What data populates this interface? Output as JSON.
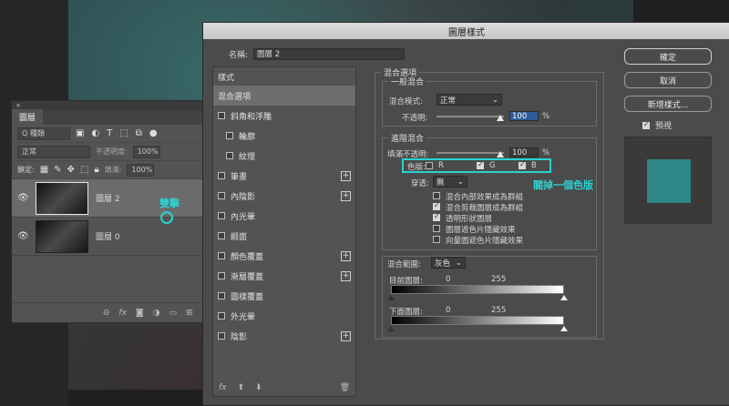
{
  "layers_panel": {
    "tab": "圖層",
    "filter": "Q 種類",
    "blend_mode": "正常",
    "opacity_label": "不透明度:",
    "opacity_value": "100%",
    "lock_label": "鎖定:",
    "fill_label": "填滿:",
    "fill_value": "100%",
    "layers": [
      {
        "name": "圖層 2",
        "selected": true
      },
      {
        "name": "圖層 0",
        "selected": false
      }
    ],
    "annotation": "雙擊"
  },
  "dialog": {
    "title": "圖層樣式",
    "name_label": "名稱:",
    "name_value": "圖層 2",
    "style_list": {
      "header": "樣式",
      "items": [
        {
          "label": "混合選項",
          "checkbox": false,
          "selected": true,
          "plus": false,
          "indent": false
        },
        {
          "label": "斜角和浮雕",
          "checkbox": true,
          "selected": false,
          "plus": false,
          "indent": false
        },
        {
          "label": "輪廓",
          "checkbox": true,
          "selected": false,
          "plus": false,
          "indent": true
        },
        {
          "label": "紋理",
          "checkbox": true,
          "selected": false,
          "plus": false,
          "indent": true
        },
        {
          "label": "筆畫",
          "checkbox": true,
          "selected": false,
          "plus": true,
          "indent": false
        },
        {
          "label": "內陰影",
          "checkbox": true,
          "selected": false,
          "plus": true,
          "indent": false
        },
        {
          "label": "內光暈",
          "checkbox": true,
          "selected": false,
          "plus": false,
          "indent": false
        },
        {
          "label": "緞面",
          "checkbox": true,
          "selected": false,
          "plus": false,
          "indent": false
        },
        {
          "label": "顏色覆蓋",
          "checkbox": true,
          "selected": false,
          "plus": true,
          "indent": false
        },
        {
          "label": "漸層覆蓋",
          "checkbox": true,
          "selected": false,
          "plus": true,
          "indent": false
        },
        {
          "label": "圖樣覆蓋",
          "checkbox": true,
          "selected": false,
          "plus": false,
          "indent": false
        },
        {
          "label": "外光暈",
          "checkbox": true,
          "selected": false,
          "plus": false,
          "indent": false
        },
        {
          "label": "陰影",
          "checkbox": true,
          "selected": false,
          "plus": true,
          "indent": false
        }
      ],
      "fx": "fx"
    },
    "blending": {
      "section_title": "混合選項",
      "general_title": "一般混合",
      "blend_mode_label": "混合模式:",
      "blend_mode_value": "正常",
      "opacity_label": "不透明:",
      "opacity_value": "100",
      "percent": "%",
      "advanced_title": "進階混合",
      "fill_opacity_label": "填滿不透明:",
      "fill_opacity_value": "100",
      "channels_label": "色版:",
      "channels": [
        {
          "name": "R",
          "checked": false
        },
        {
          "name": "G",
          "checked": true
        },
        {
          "name": "B",
          "checked": true
        }
      ],
      "knockout_label": "穿透:",
      "knockout_value": "無",
      "options": [
        {
          "label": "混合內部效果成為群組",
          "checked": false
        },
        {
          "label": "混合剪裁圖層成為群組",
          "checked": true
        },
        {
          "label": "透明形狀圖層",
          "checked": true
        },
        {
          "label": "圖層遮色片隱藏效果",
          "checked": false
        },
        {
          "label": "向量圖遮色片隱藏效果",
          "checked": false
        }
      ],
      "annotation": "關掉一個色版",
      "blend_if_label": "混合範圍:",
      "blend_if_value": "灰色",
      "this_layer_label": "目前圖層:",
      "this_layer_min": "0",
      "this_layer_max": "255",
      "underlying_label": "下面圖層:",
      "underlying_min": "0",
      "underlying_max": "255"
    },
    "buttons": {
      "ok": "確定",
      "cancel": "取消",
      "new_style": "新增樣式...",
      "preview_label": "預視",
      "preview_checked": true
    },
    "preview_color": "#2e8686"
  }
}
